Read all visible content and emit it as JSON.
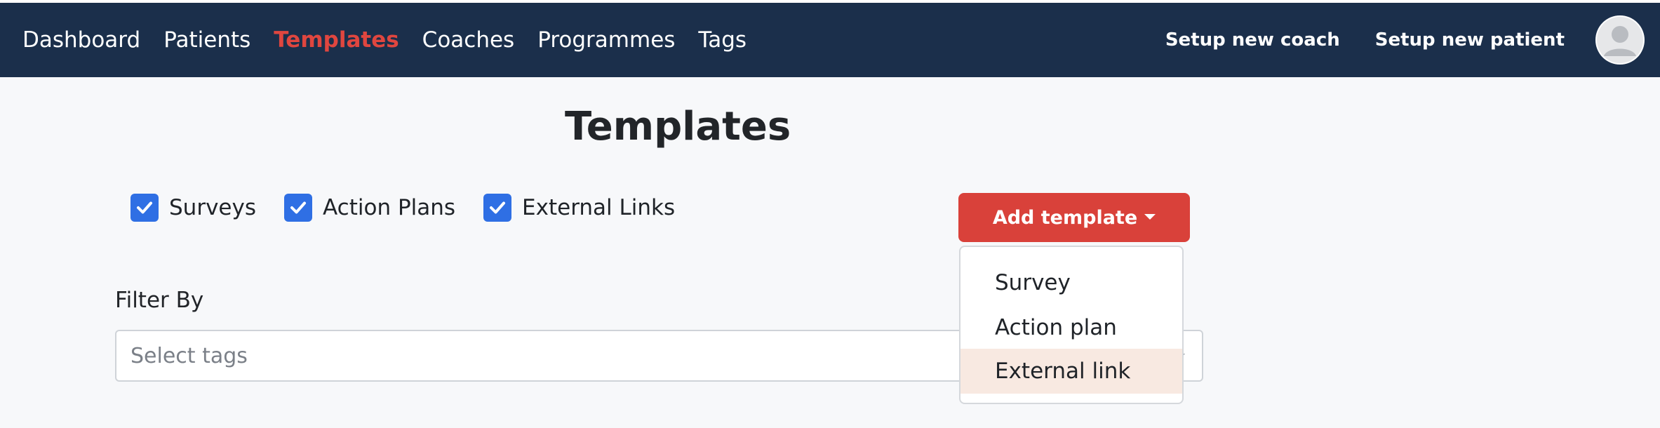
{
  "navbar": {
    "links": [
      {
        "label": "Dashboard"
      },
      {
        "label": "Patients"
      },
      {
        "label": "Templates",
        "active": true
      },
      {
        "label": "Coaches"
      },
      {
        "label": "Programmes"
      },
      {
        "label": "Tags"
      }
    ],
    "actions": {
      "setup_coach": "Setup new coach",
      "setup_patient": "Setup new patient"
    },
    "avatar_icon": "user-avatar-icon"
  },
  "page": {
    "title": "Templates"
  },
  "filters": {
    "checkboxes": [
      {
        "label": "Surveys",
        "checked": true
      },
      {
        "label": "Action Plans",
        "checked": true
      },
      {
        "label": "External Links",
        "checked": true
      }
    ],
    "filter_by_label": "Filter By",
    "tags_placeholder": "Select tags"
  },
  "add_template": {
    "label": "Add template",
    "menu_items": [
      {
        "label": "Survey"
      },
      {
        "label": "Action plan"
      },
      {
        "label": "External link",
        "hovered": true
      }
    ]
  },
  "colors": {
    "navbar_bg": "#1b2f4b",
    "accent_red": "#d9413a",
    "active_link": "#e0463f",
    "checkbox_blue": "#2f6fe4",
    "menu_hover": "#f8e9e1"
  }
}
